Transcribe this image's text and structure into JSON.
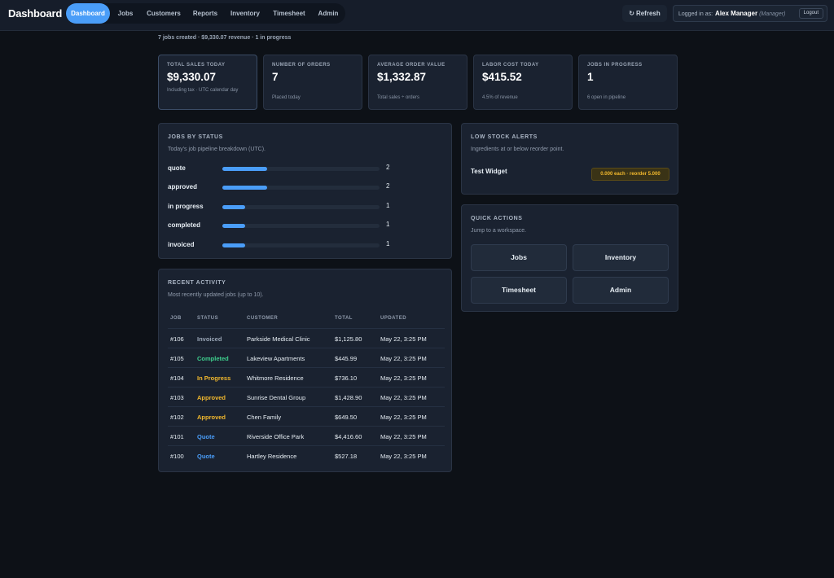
{
  "header": {
    "brand": "Dashboard",
    "nav": [
      {
        "label": "Dashboard",
        "active": true
      },
      {
        "label": "Jobs",
        "active": false
      },
      {
        "label": "Customers",
        "active": false
      },
      {
        "label": "Reports",
        "active": false
      },
      {
        "label": "Inventory",
        "active": false
      },
      {
        "label": "Timesheet",
        "active": false
      },
      {
        "label": "Admin",
        "active": false
      }
    ],
    "refresh_label": "Refresh",
    "refresh_icon": "↻",
    "logged_in_prefix": "Logged in as:",
    "user_name": "Alex Manager",
    "user_role": "(Manager)",
    "logout_label": "Logout"
  },
  "summary": "7 jobs created · $9,330.07 revenue · 1 in progress",
  "kpis": [
    {
      "label": "TOTAL SALES TODAY",
      "value": "$9,330.07",
      "sub": "Including tax · UTC calendar day"
    },
    {
      "label": "NUMBER OF ORDERS",
      "value": "7",
      "sub": "Placed today"
    },
    {
      "label": "AVERAGE ORDER VALUE",
      "value": "$1,332.87",
      "sub": "Total sales ÷ orders"
    },
    {
      "label": "LABOR COST TODAY",
      "value": "$415.52",
      "sub": "4.5% of revenue"
    },
    {
      "label": "JOBS IN PROGRESS",
      "value": "1",
      "sub": "6 open in pipeline"
    }
  ],
  "jobs_by_status": {
    "title": "JOBS BY STATUS",
    "subtitle": "Today's job pipeline breakdown (UTC).",
    "max": 7,
    "rows": [
      {
        "name": "quote",
        "count": "2",
        "fraction": 0.2857
      },
      {
        "name": "approved",
        "count": "2",
        "fraction": 0.2857
      },
      {
        "name": "in progress",
        "count": "1",
        "fraction": 0.1429
      },
      {
        "name": "completed",
        "count": "1",
        "fraction": 0.1429
      },
      {
        "name": "invoiced",
        "count": "1",
        "fraction": 0.1429
      }
    ]
  },
  "recent_activity": {
    "title": "RECENT ACTIVITY",
    "subtitle": "Most recently updated jobs (up to 10).",
    "columns": [
      "JOB",
      "STATUS",
      "CUSTOMER",
      "TOTAL",
      "UPDATED"
    ],
    "rows": [
      {
        "job": "#106",
        "status": "Invoiced",
        "status_color": "#9aa6b6",
        "customer": "Parkside Medical Clinic",
        "total": "$1,125.80",
        "updated": "May 22, 3:25 PM"
      },
      {
        "job": "#105",
        "status": "Completed",
        "status_color": "#3ecf8e",
        "customer": "Lakeview Apartments",
        "total": "$445.99",
        "updated": "May 22, 3:25 PM"
      },
      {
        "job": "#104",
        "status": "In Progress",
        "status_color": "#f3b92d",
        "customer": "Whitmore Residence",
        "total": "$736.10",
        "updated": "May 22, 3:25 PM"
      },
      {
        "job": "#103",
        "status": "Approved",
        "status_color": "#f3b92d",
        "customer": "Sunrise Dental Group",
        "total": "$1,428.90",
        "updated": "May 22, 3:25 PM"
      },
      {
        "job": "#102",
        "status": "Approved",
        "status_color": "#f3b92d",
        "customer": "Chen Family",
        "total": "$649.50",
        "updated": "May 22, 3:25 PM"
      },
      {
        "job": "#101",
        "status": "Quote",
        "status_color": "#4a9df8",
        "customer": "Riverside Office Park",
        "total": "$4,416.60",
        "updated": "May 22, 3:25 PM"
      },
      {
        "job": "#100",
        "status": "Quote",
        "status_color": "#4a9df8",
        "customer": "Hartley Residence",
        "total": "$527.18",
        "updated": "May 22, 3:25 PM"
      }
    ]
  },
  "low_stock": {
    "title": "LOW STOCK ALERTS",
    "subtitle": "Ingredients at or below reorder point.",
    "item_name": "Test Widget",
    "item_badge": "0.000 each · reorder 5.000"
  },
  "quick_actions": {
    "title": "QUICK ACTIONS",
    "subtitle": "Jump to a workspace.",
    "buttons": [
      "Jobs",
      "Inventory",
      "Timesheet",
      "Admin"
    ]
  }
}
